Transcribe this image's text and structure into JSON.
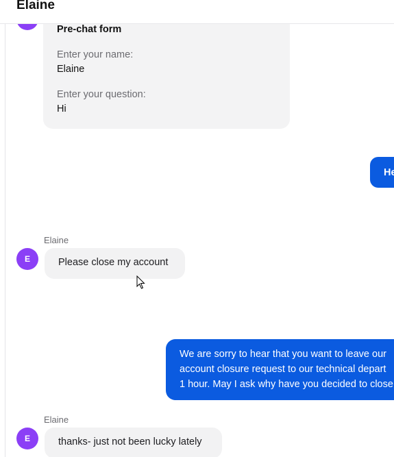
{
  "header": {
    "title": "Elaine"
  },
  "prechat": {
    "title": "Pre-chat form",
    "name_label": "Enter your name:",
    "name_value": "Elaine",
    "question_label": "Enter your question:",
    "question_value": "Hi"
  },
  "messages": [
    {
      "direction": "outgoing",
      "text": "He"
    },
    {
      "direction": "incoming",
      "sender": "Elaine",
      "avatar": "E",
      "text": "Please close my account"
    },
    {
      "direction": "outgoing",
      "lines": [
        "We are sorry to hear that you want to leave our",
        "account closure request to our technical depart",
        "1 hour. May I ask why have you decided to close"
      ]
    },
    {
      "direction": "incoming",
      "sender": "Elaine",
      "avatar": "E",
      "text": "thanks- just not been lucky lately"
    }
  ],
  "colors": {
    "avatar": "#8b3ff6",
    "agent_bubble": "#0b5be0",
    "user_bubble": "#f2f2f3"
  },
  "icons": {
    "cursor": "mouse-pointer-icon"
  }
}
